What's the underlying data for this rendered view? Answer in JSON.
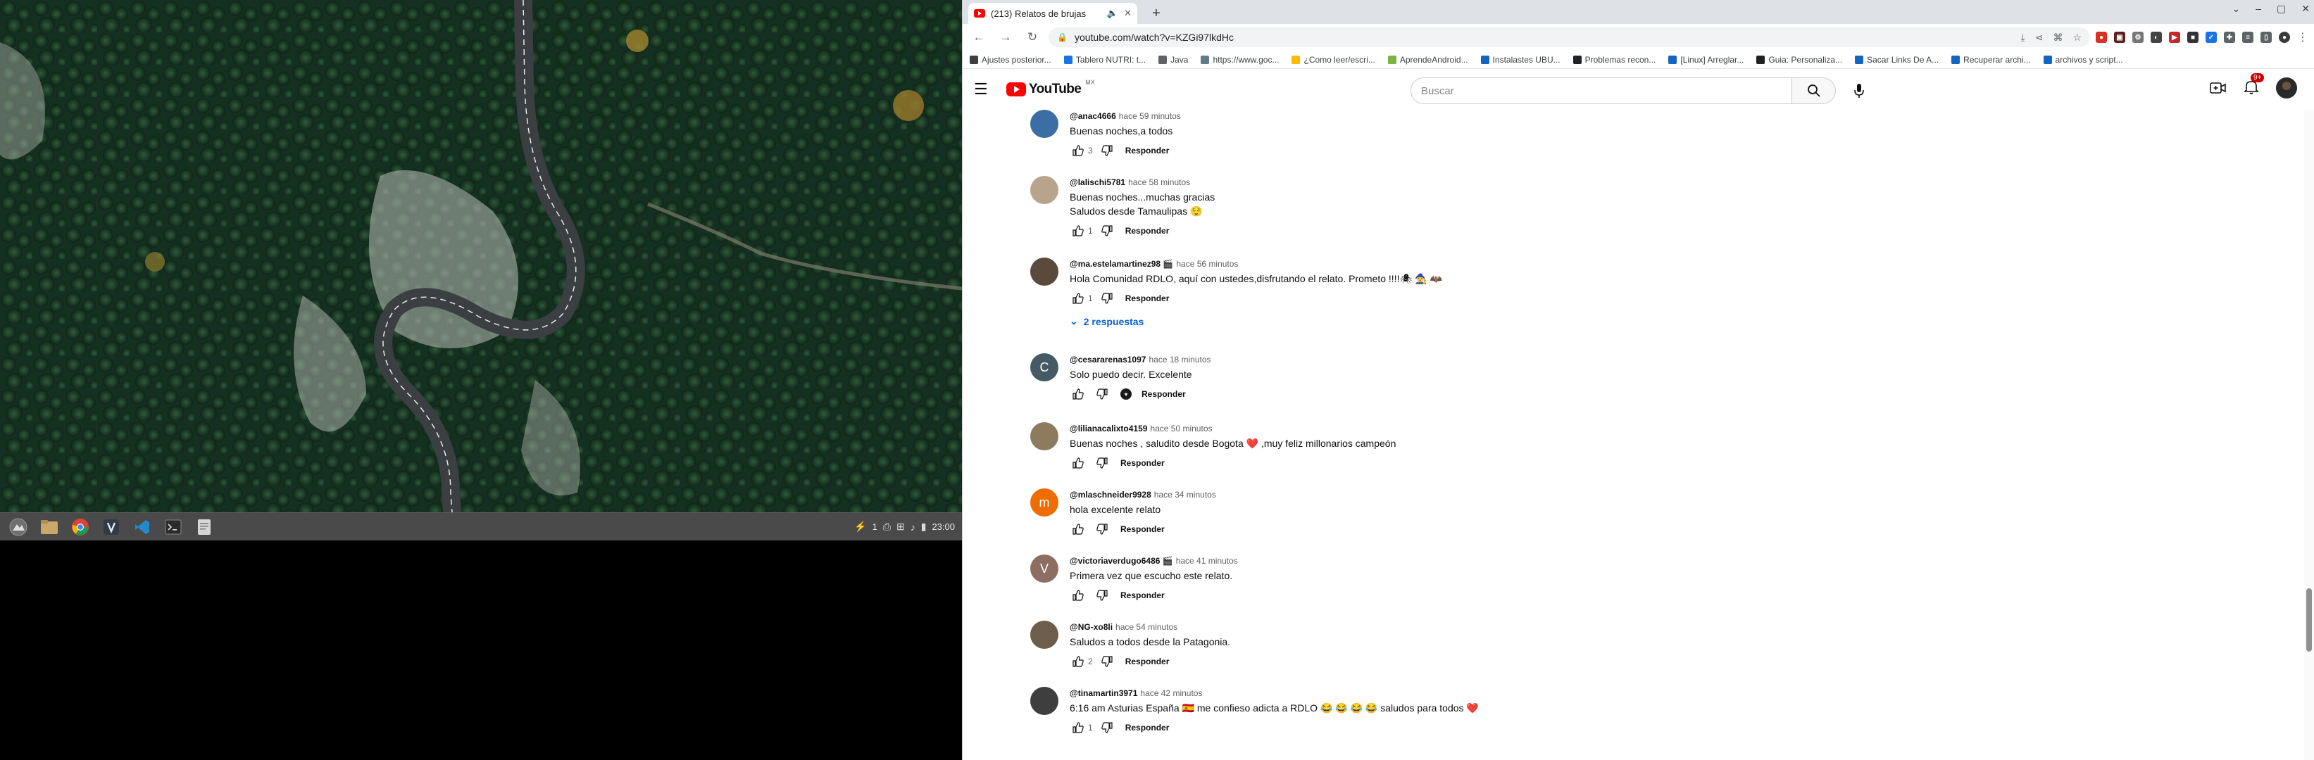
{
  "taskbar": {
    "apps": [
      {
        "name": "system-menu-icon"
      },
      {
        "name": "file-manager-icon"
      },
      {
        "name": "chrome-icon"
      },
      {
        "name": "vscodium-icon"
      },
      {
        "name": "vscode-icon"
      },
      {
        "name": "terminal-icon"
      },
      {
        "name": "text-editor-icon"
      }
    ],
    "tray_count": "1",
    "clock": "23:00"
  },
  "browser": {
    "tab_title": "(213) Relatos de brujas",
    "address": "youtube.com/watch?v=KZGi97lkdHc",
    "bookmarks": [
      {
        "label": "Ajustes posterior...",
        "color": "#3c4043"
      },
      {
        "label": "Tablero NUTRI: t...",
        "color": "#1a73e8"
      },
      {
        "label": "Java",
        "color": "#5f6368"
      },
      {
        "label": "https://www.goc...",
        "color": "#607d8b"
      },
      {
        "label": "¿Como leer/escri...",
        "color": "#fbbc04"
      },
      {
        "label": "AprendeAndroid...",
        "color": "#7cb342"
      },
      {
        "label": "Instalastes UBU...",
        "color": "#1565c0"
      },
      {
        "label": "Problemas recon...",
        "color": "#202124"
      },
      {
        "label": "[Linux] Arreglar...",
        "color": "#1565c0"
      },
      {
        "label": "Guia: Personaliza...",
        "color": "#202124"
      },
      {
        "label": "Sacar Links De A...",
        "color": "#1565c0"
      },
      {
        "label": "Recuperar archi...",
        "color": "#1565c0"
      },
      {
        "label": "archivos y script...",
        "color": "#1565c0"
      }
    ]
  },
  "youtube": {
    "logo_text": "YouTube",
    "country": "MX",
    "search_placeholder": "Buscar",
    "notif_badge": "9+",
    "reply_label": "Responder",
    "comments": [
      {
        "author": "@anac4666",
        "time": "hace 59 minutos",
        "lines": [
          "Buenas noches,a todos"
        ],
        "likes": "3",
        "avatar_color": "#3a6ea5",
        "avatar_letter": ""
      },
      {
        "author": "@lalischi5781",
        "time": "hace 58 minutos",
        "lines": [
          "Buenas noches...muchas gracias",
          "Saludos desde Tamaulipas 😌"
        ],
        "likes": "1",
        "avatar_color": "#b8a38c",
        "avatar_letter": ""
      },
      {
        "author": "@ma.estelamartinez98 🎬",
        "time": "hace 56 minutos",
        "lines": [
          "Hola Comunidad RDLO, aquí con ustedes,disfrutando el relato. Prometo !!!!🕷 🧙 🦇"
        ],
        "likes": "1",
        "avatar_color": "#5b4a3c",
        "avatar_letter": "",
        "replies": "2 respuestas"
      },
      {
        "author": "@cesararenas1097",
        "time": "hace 18 minutos",
        "lines": [
          "Solo puedo decir. Excelente"
        ],
        "likes": "",
        "avatar_color": "#455a64",
        "avatar_letter": "C",
        "creator_heart": true
      },
      {
        "author": "@lilianacalixto4159",
        "time": "hace 50 minutos",
        "lines": [
          "Buenas noches , saludito desde Bogota ❤️ ,muy feliz millonarios campeón"
        ],
        "likes": "",
        "avatar_color": "#8d7b5e",
        "avatar_letter": ""
      },
      {
        "author": "@mlaschneider9928",
        "time": "hace 34 minutos",
        "lines": [
          "hola excelente relato"
        ],
        "likes": "",
        "avatar_color": "#ef6c00",
        "avatar_letter": "m"
      },
      {
        "author": "@victoriaverdugo6486 🎬",
        "time": "hace 41 minutos",
        "lines": [
          "Primera vez que escucho este relato."
        ],
        "likes": "",
        "avatar_color": "#8d6e63",
        "avatar_letter": "V"
      },
      {
        "author": "@NG-xo8li",
        "time": "hace 54 minutos",
        "lines": [
          "Saludos a todos desde la Patagonia."
        ],
        "likes": "2",
        "avatar_color": "#6d5d4b",
        "avatar_letter": ""
      },
      {
        "author": "@tinamartin3971",
        "time": "hace 42 minutos",
        "lines": [
          "6:16 am Asturias España 🇪🇸 me confieso adicta a RDLO 😂 😂 😂 😂 saludos para todos ❤️"
        ],
        "likes": "1",
        "avatar_color": "#3e3e3e",
        "avatar_letter": ""
      }
    ]
  }
}
